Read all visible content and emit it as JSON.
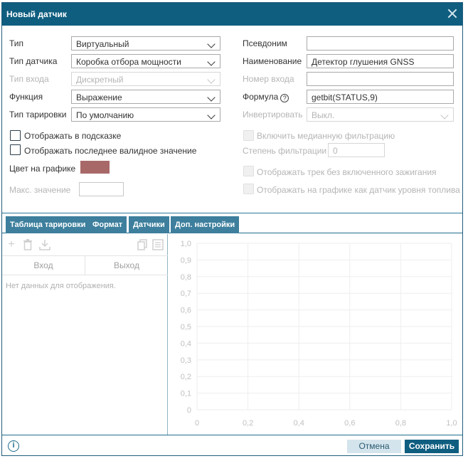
{
  "dialog": {
    "title": "Новый датчик"
  },
  "left_form": {
    "type_label": "Тип",
    "type_value": "Виртуальный",
    "sensor_type_label": "Тип датчика",
    "sensor_type_value": "Коробка отбора мощности",
    "input_type_label": "Тип входа",
    "input_type_value": "Дискретный",
    "function_label": "Функция",
    "function_value": "Выражение",
    "calibration_type_label": "Тип тарировки",
    "calibration_type_value": "По умолчанию",
    "show_in_tooltip_label": "Отображать в подсказке",
    "show_last_valid_label": "Отображать последнее валидное значение",
    "chart_color_label": "Цвет на графике",
    "chart_color": "#a86868",
    "max_value_label": "Макс. значение",
    "max_value": ""
  },
  "right_form": {
    "alias_label": "Псевдоним",
    "alias_value": "",
    "name_label": "Наименование",
    "name_value": "Детектор глушения GNSS",
    "input_number_label": "Номер входа",
    "input_number_value": "",
    "formula_label": "Формула",
    "formula_help": "?",
    "formula_value": "getbit(STATUS,9)",
    "invert_label": "Инвертировать",
    "invert_value": "Выкл.",
    "median_filter_label": "Включить медианную фильтрацию",
    "filter_degree_label": "Степень фильтрации",
    "filter_degree_value": "0",
    "show_track_label": "Отображать трек без включенного зажигания",
    "show_as_fuel_label": "Отображать на графике как датчик уровня топлива"
  },
  "tabs": [
    {
      "label": "Таблица тарировки"
    },
    {
      "label": "Формат"
    },
    {
      "label": "Датчики"
    },
    {
      "label": "Доп. настройки"
    }
  ],
  "calibration_table": {
    "toolbar_icons": [
      "add-icon",
      "delete-icon",
      "import-icon",
      "copy-icon",
      "list-icon"
    ],
    "columns": [
      "Вход",
      "Выход"
    ],
    "empty_text": "Нет данных для отображения."
  },
  "chart_data": {
    "type": "line",
    "series": [],
    "xlim": [
      0,
      1
    ],
    "ylim": [
      0,
      1
    ],
    "xticks": [
      "0",
      "0,2",
      "0,4",
      "0,6",
      "0,8",
      "1,0"
    ],
    "yticks": [
      "0",
      "0,1",
      "0,2",
      "0,3",
      "0,4",
      "0,5",
      "0,6",
      "0,7",
      "0,8",
      "0,9",
      "1,0"
    ],
    "grid": true
  },
  "footer": {
    "info_icon": "i",
    "cancel_label": "Отмена",
    "save_label": "Сохранить"
  }
}
